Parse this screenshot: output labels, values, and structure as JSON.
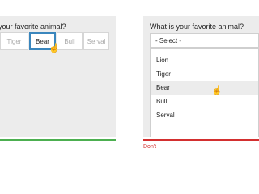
{
  "left_example": {
    "question": "your favorite animal?",
    "options": [
      {
        "label": "Tiger",
        "selected": false
      },
      {
        "label": "Bear",
        "selected": true
      },
      {
        "label": "Bull",
        "selected": false
      },
      {
        "label": "Serval",
        "selected": false
      }
    ],
    "cursor_icon": "hand-pointer-icon"
  },
  "right_example": {
    "question": "What is your favorite animal?",
    "select_value": "- Select -",
    "options": [
      "Lion",
      "Tiger",
      "Bear",
      "Bull",
      "Serval"
    ],
    "hovered_option": "Bear",
    "cursor_icon": "hand-pointer-icon"
  },
  "captions": {
    "dont": "Don't"
  },
  "colors": {
    "do_bar": "#4caf50",
    "dont_bar": "#d32f2f",
    "selected_border": "#3a86bd"
  }
}
